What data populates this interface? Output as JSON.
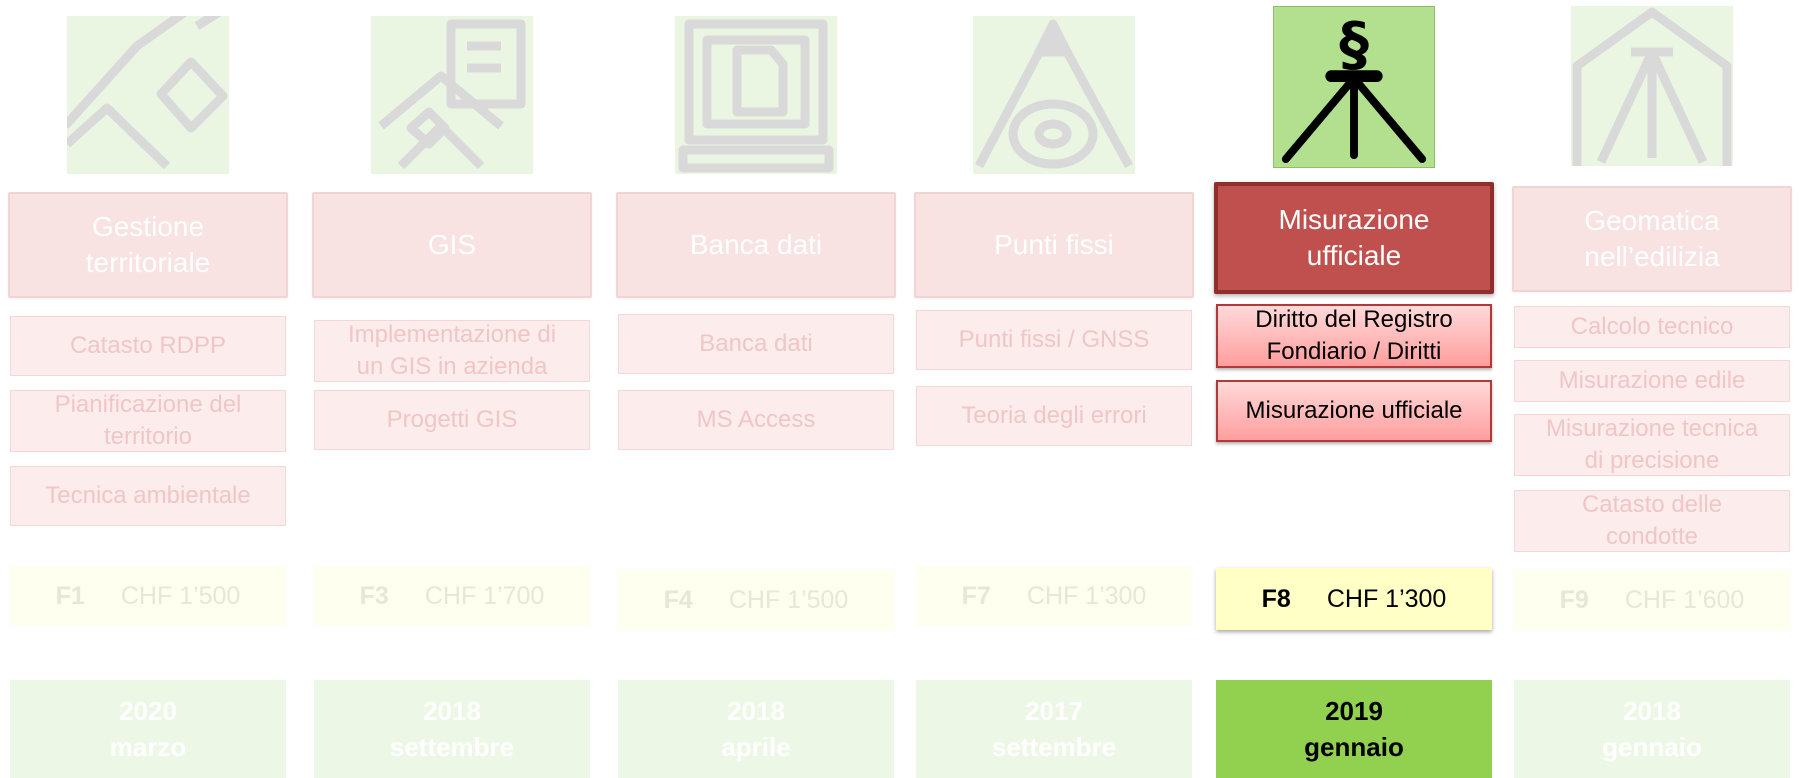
{
  "colors": {
    "faded_title": "#f8e2e2",
    "active_title": "#c0504d",
    "active_module": "#ff9e9e",
    "active_price": "#ffffc6",
    "active_date": "#92d050"
  },
  "courses": [
    {
      "icon": "land-parcel-icon",
      "title": "Gestione\nterritoriale",
      "modules": [
        "Catasto RDPP",
        "Pianificazione del\nterritorio",
        "Tecnica ambientale"
      ],
      "code": "F1",
      "price": "CHF 1’500",
      "year": "2020",
      "month": "marzo"
    },
    {
      "icon": "gis-map-icon",
      "title": "GIS",
      "modules": [
        "Implementazione di\nun GIS in azienda",
        "Progetti GIS"
      ],
      "code": "F3",
      "price": "CHF 1’700",
      "year": "2018",
      "month": "settembre"
    },
    {
      "icon": "computer-document-icon",
      "title": "Banca dati",
      "modules": [
        "Banca dati",
        "MS Access"
      ],
      "code": "F4",
      "price": "CHF 1’500",
      "year": "2018",
      "month": "aprile"
    },
    {
      "icon": "fixed-point-icon",
      "title": "Punti fissi",
      "modules": [
        "Punti fissi / GNSS",
        "Teoria degli errori"
      ],
      "code": "F7",
      "price": "CHF 1’300",
      "year": "2017",
      "month": "settembre"
    },
    {
      "icon": "paragraph-tripod-icon",
      "title": "Misurazione\nufficiale",
      "modules": [
        "Diritto del Registro\nFondiario / Diritti",
        "Misurazione ufficiale"
      ],
      "code": "F8",
      "price": "CHF 1’300",
      "year": "2019",
      "month": "gennaio",
      "active": true
    },
    {
      "icon": "tripod-building-icon",
      "title": "Geomatica\nnell’edilizia",
      "modules": [
        "Calcolo tecnico",
        "Misurazione edile",
        "Misurazione tecnica\ndi precisione",
        "Catasto delle\ncondotte"
      ],
      "code": "F9",
      "price": "CHF 1’600",
      "year": "2018",
      "month": "gennaio"
    }
  ]
}
